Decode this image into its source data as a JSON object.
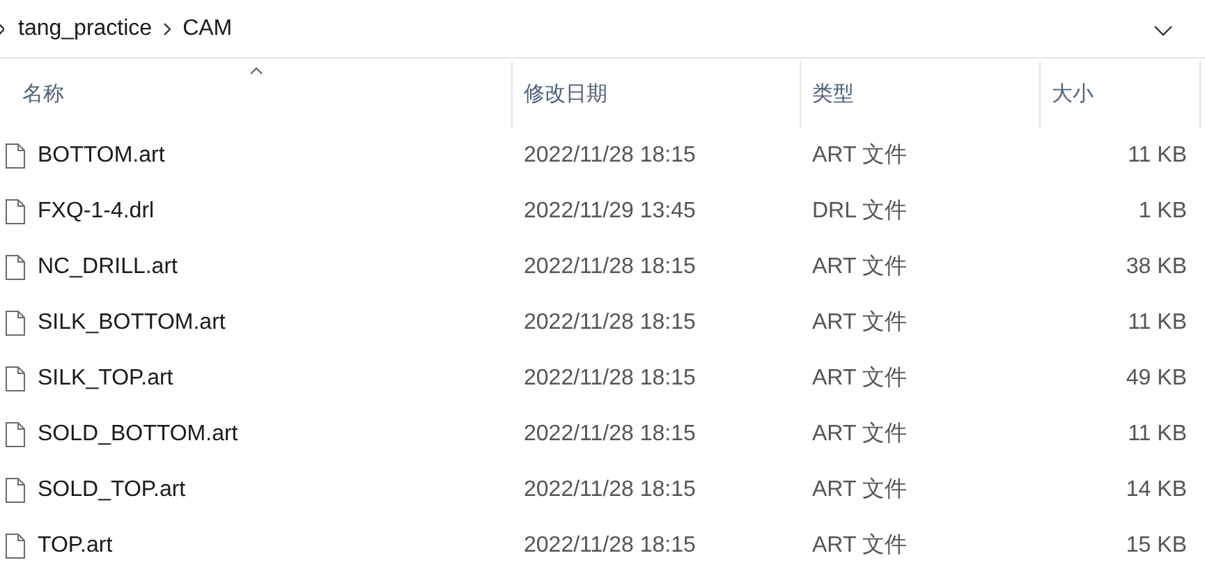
{
  "breadcrumb": [
    "tang_practice",
    "CAM"
  ],
  "columns": [
    {
      "label": "名称",
      "sorted": true
    },
    {
      "label": "修改日期",
      "sorted": false
    },
    {
      "label": "类型",
      "sorted": false
    },
    {
      "label": "大小",
      "sorted": false
    }
  ],
  "files": [
    {
      "name": "BOTTOM.art",
      "date": "2022/11/28 18:15",
      "type": "ART 文件",
      "size": "11 KB"
    },
    {
      "name": "FXQ-1-4.drl",
      "date": "2022/11/29 13:45",
      "type": "DRL 文件",
      "size": "1 KB"
    },
    {
      "name": "NC_DRILL.art",
      "date": "2022/11/28 18:15",
      "type": "ART 文件",
      "size": "38 KB"
    },
    {
      "name": "SILK_BOTTOM.art",
      "date": "2022/11/28 18:15",
      "type": "ART 文件",
      "size": "11 KB"
    },
    {
      "name": "SILK_TOP.art",
      "date": "2022/11/28 18:15",
      "type": "ART 文件",
      "size": "49 KB"
    },
    {
      "name": "SOLD_BOTTOM.art",
      "date": "2022/11/28 18:15",
      "type": "ART 文件",
      "size": "11 KB"
    },
    {
      "name": "SOLD_TOP.art",
      "date": "2022/11/28 18:15",
      "type": "ART 文件",
      "size": "14 KB"
    },
    {
      "name": "TOP.art",
      "date": "2022/11/28 18:15",
      "type": "ART 文件",
      "size": "15 KB"
    }
  ]
}
